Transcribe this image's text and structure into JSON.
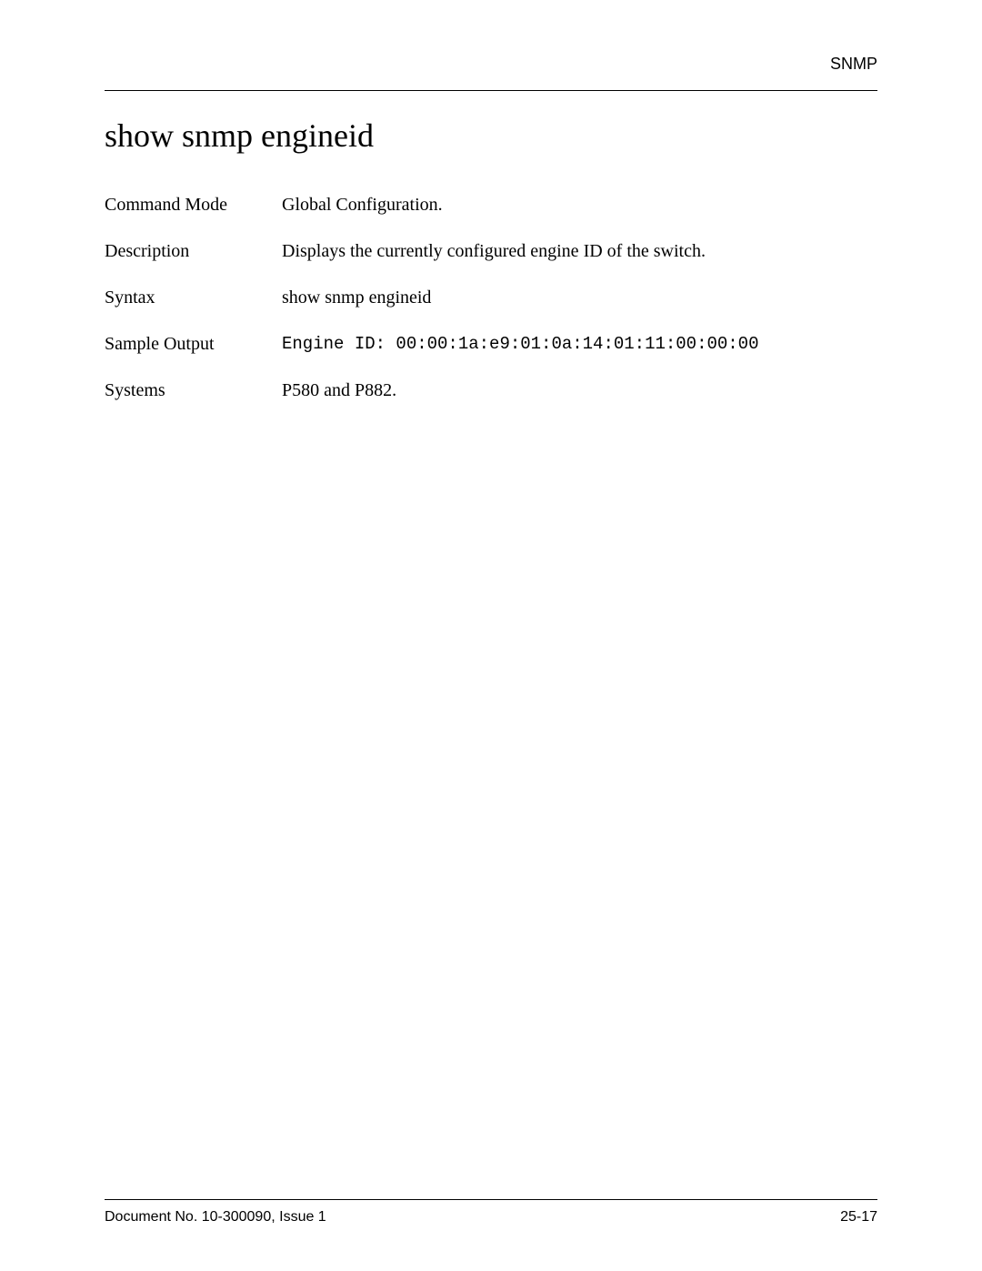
{
  "header": {
    "section": "SNMP"
  },
  "title": "show snmp engineid",
  "definitions": [
    {
      "label": "Command Mode",
      "value": "Global Configuration.",
      "mono": false
    },
    {
      "label": "Description",
      "value": "Displays the currently configured engine ID of the switch.",
      "mono": false
    },
    {
      "label": "Syntax",
      "value": "show snmp engineid",
      "mono": false
    },
    {
      "label": "Sample Output",
      "value": "Engine ID: 00:00:1a:e9:01:0a:14:01:11:00:00:00",
      "mono": true
    },
    {
      "label": "Systems",
      "value": "P580 and P882.",
      "mono": false
    }
  ],
  "footer": {
    "doc": "Document No. 10-300090, Issue 1",
    "page": "25-17"
  }
}
